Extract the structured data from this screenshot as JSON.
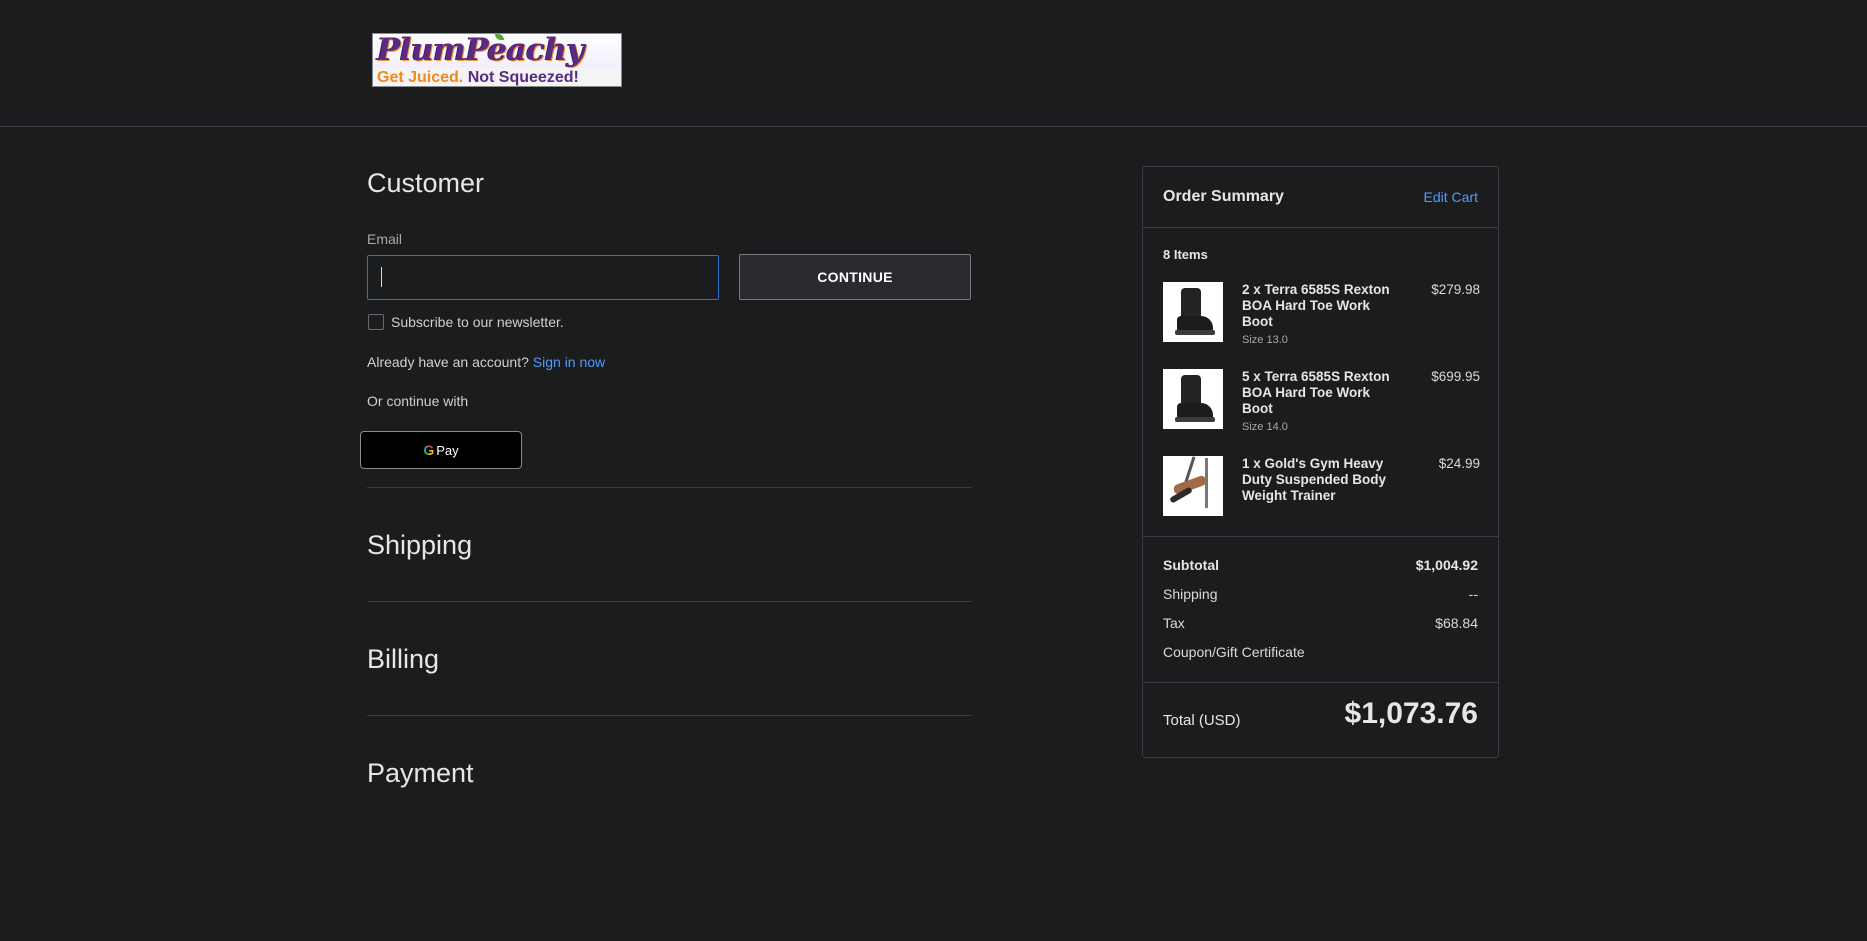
{
  "brand": {
    "logo_title": "PlumPeachy",
    "tagline_a": "Get Juiced.",
    "tagline_b": "Not Squeezed!"
  },
  "customer": {
    "heading": "Customer",
    "email_label": "Email",
    "email_value": "",
    "continue_label": "CONTINUE",
    "newsletter_label": "Subscribe to our newsletter.",
    "newsletter_checked": false,
    "account_prompt": "Already have an account?",
    "sign_in_link": "Sign in now",
    "alt_checkout_label": "Or continue with",
    "gpay_label": "Pay",
    "gpay_g": "G"
  },
  "sections": {
    "shipping": "Shipping",
    "billing": "Billing",
    "payment": "Payment"
  },
  "summary": {
    "title": "Order Summary",
    "edit_cart": "Edit Cart",
    "items_count": "8 Items",
    "items": [
      {
        "name": "2 x Terra 6585S Rexton BOA Hard Toe Work Boot",
        "size": "Size 13.0",
        "price": "$279.98",
        "thumb_icon": "boot-image"
      },
      {
        "name": "5 x Terra 6585S Rexton BOA Hard Toe Work Boot",
        "size": "Size 14.0",
        "price": "$699.95",
        "thumb_icon": "boot-image"
      },
      {
        "name": "1 x Gold's Gym Heavy Duty Suspended Body Weight Trainer",
        "size": "",
        "price": "$24.99",
        "thumb_icon": "suspension-trainer-image"
      }
    ],
    "subtotal_label": "Subtotal",
    "subtotal_value": "$1,004.92",
    "shipping_label": "Shipping",
    "shipping_value": "--",
    "tax_label": "Tax",
    "tax_value": "$68.84",
    "coupon_link": "Coupon/Gift Certificate",
    "total_label": "Total (USD)",
    "total_value": "$1,073.76"
  },
  "colors": {
    "background": "#1b1c1e",
    "link": "#4f9bff",
    "input_focus": "#2f6fd1",
    "border": "#3a3b3e"
  }
}
